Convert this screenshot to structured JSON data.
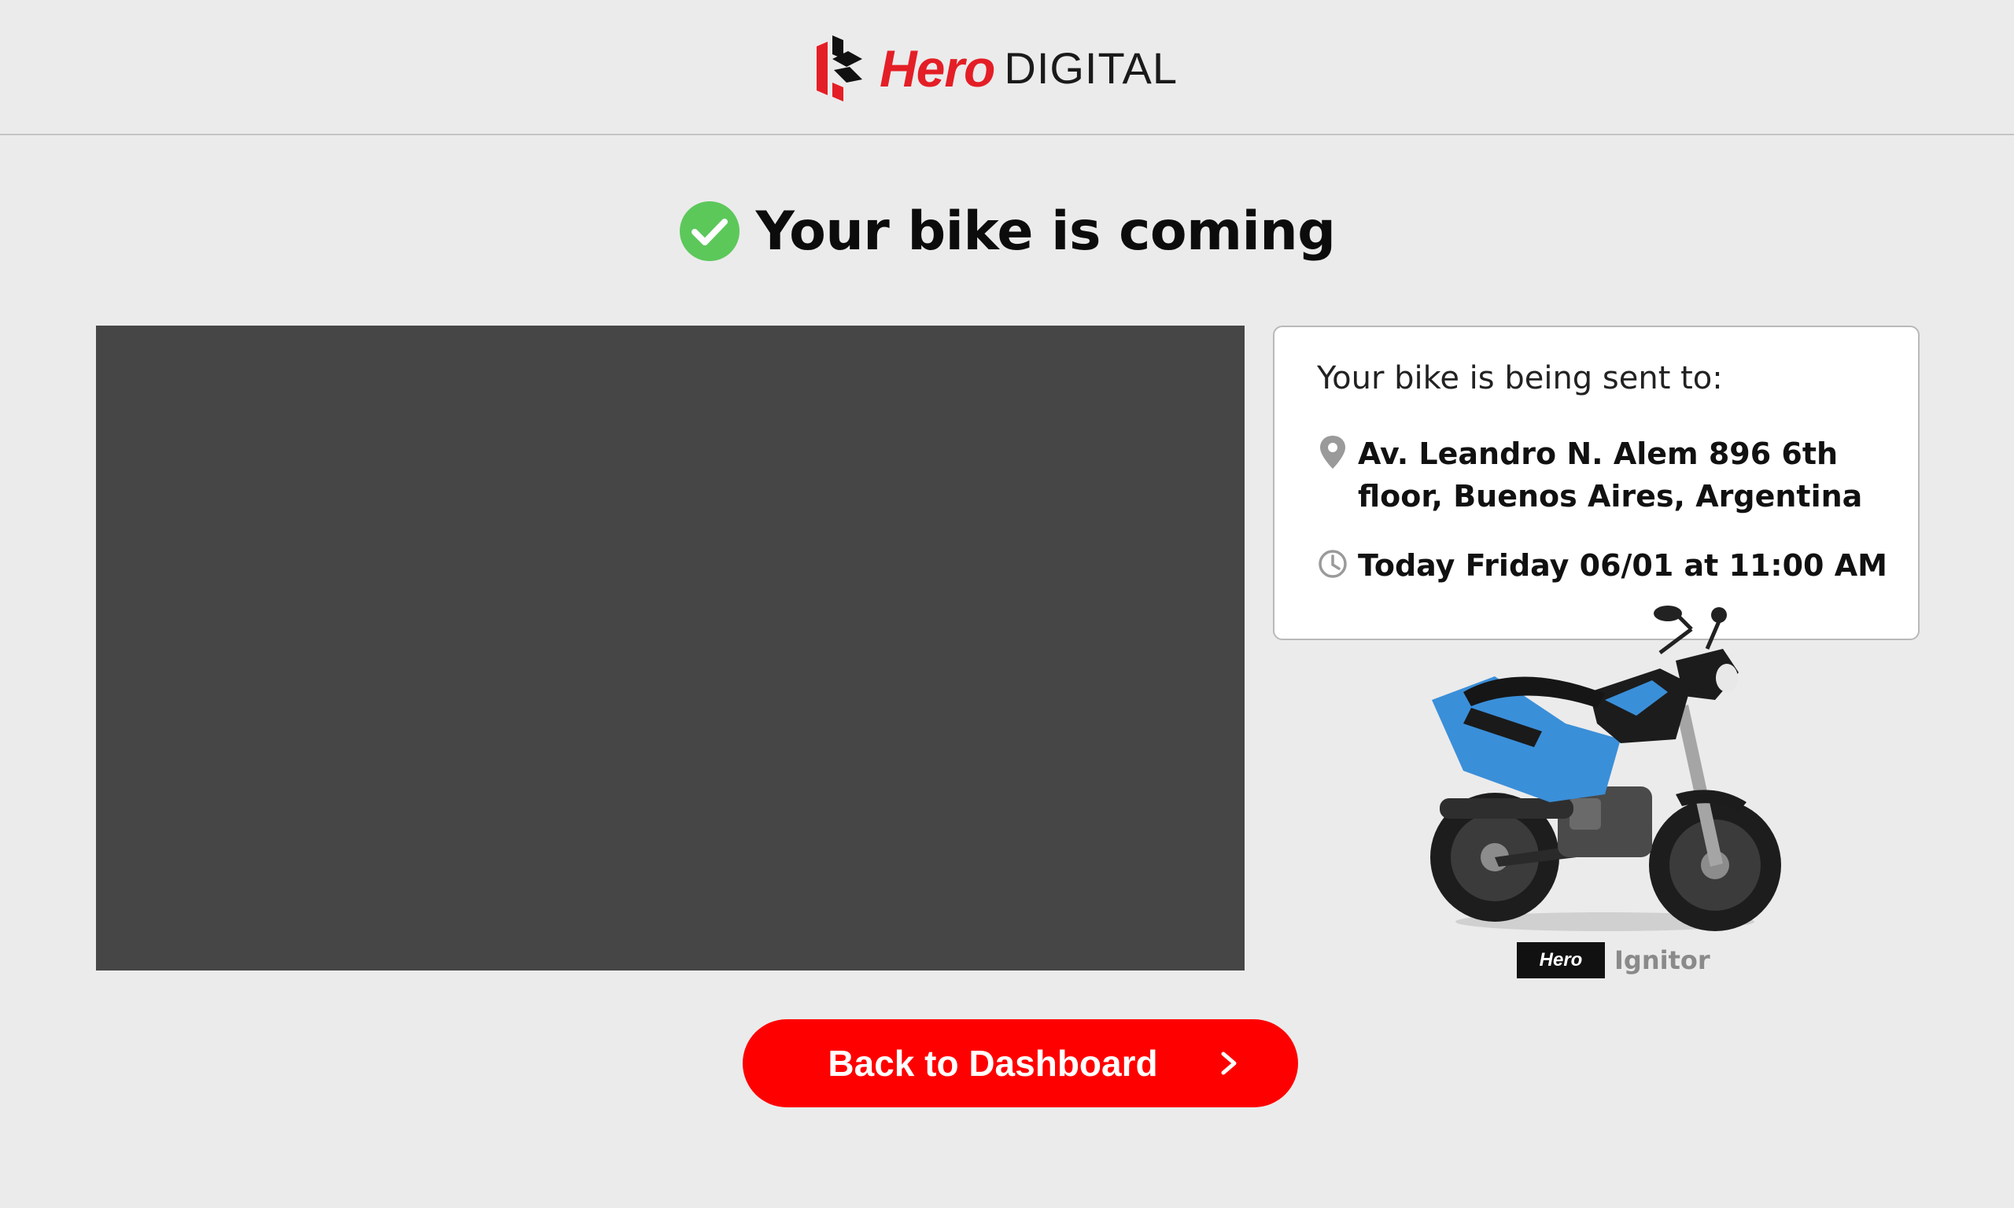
{
  "header": {
    "brand_primary": "Hero",
    "brand_secondary": "DIGITAL",
    "brand_color": "#e41e26"
  },
  "status": {
    "title": "Your bike is coming",
    "icon": "check-circle-icon",
    "icon_color": "#5cc85a"
  },
  "delivery": {
    "heading": "Your bike is being sent to:",
    "address": "Av. Leandro N. Alem 896 6th floor, Buenos Aires, Argentina",
    "address_icon": "location-pin-icon",
    "time": "Today Friday 06/01 at 11:00 AM",
    "time_icon": "clock-icon"
  },
  "bike": {
    "badge_brand": "Hero",
    "model": "Ignitor",
    "accent_color": "#3a8fd9"
  },
  "actions": {
    "back_label": "Back to Dashboard",
    "button_color": "#ff0000"
  }
}
